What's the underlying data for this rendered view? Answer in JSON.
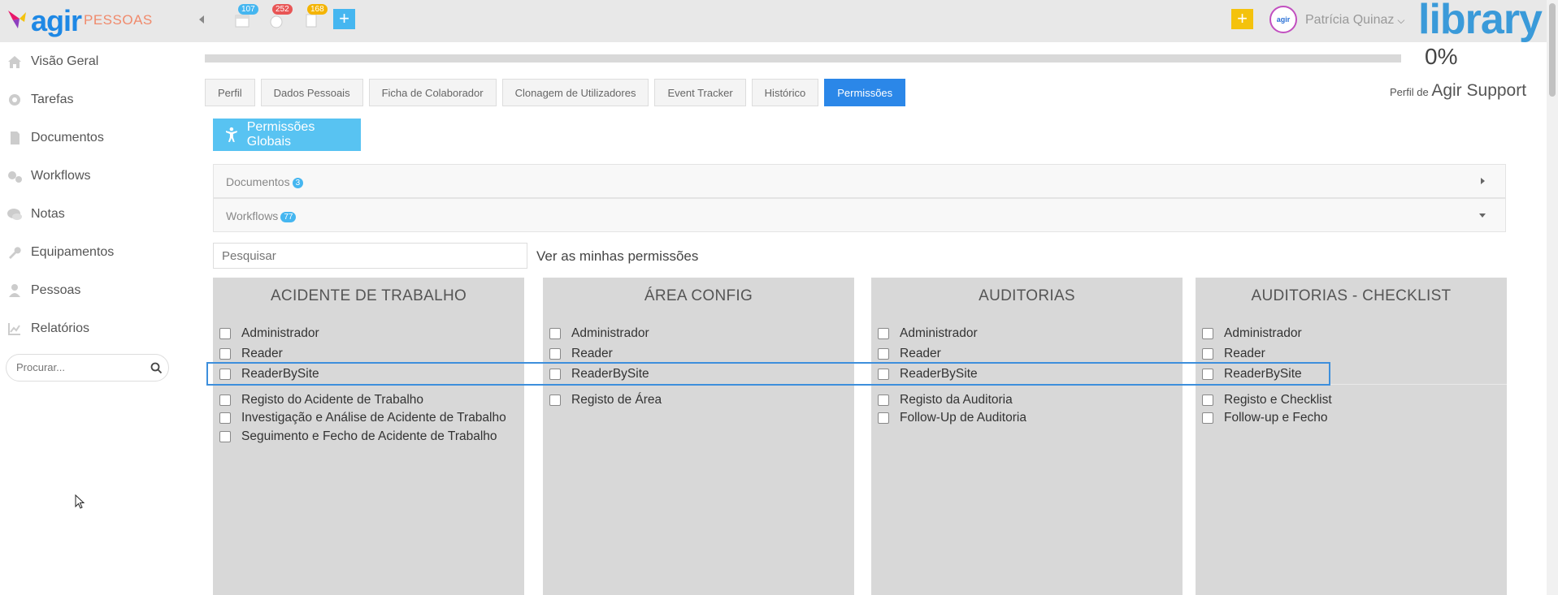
{
  "app": {
    "logo_text": "agir",
    "module": "PESSOAS",
    "brand": "library",
    "accent_color": "#2b87e8",
    "badge_counts": [
      "107",
      "252",
      "168"
    ],
    "user_name": "Patrícia Quinaz",
    "avatar_text": "agir"
  },
  "sidebar": {
    "items": [
      {
        "label": "Visão Geral",
        "icon": "home-icon"
      },
      {
        "label": "Tarefas",
        "icon": "gear-icon"
      },
      {
        "label": "Documentos",
        "icon": "document-icon"
      },
      {
        "label": "Workflows",
        "icon": "gears-icon"
      },
      {
        "label": "Notas",
        "icon": "chat-icon"
      },
      {
        "label": "Equipamentos",
        "icon": "wrench-icon"
      },
      {
        "label": "Pessoas",
        "icon": "person-icon"
      },
      {
        "label": "Relatórios",
        "icon": "chart-icon"
      }
    ],
    "search_placeholder": "Procurar..."
  },
  "progress": {
    "value": 0,
    "label": "0%"
  },
  "tabs": [
    "Perfil",
    "Dados Pessoais",
    "Ficha de Colaborador",
    "Clonagem de Utilizadores",
    "Event Tracker",
    "Histórico",
    "Permissões"
  ],
  "active_tab": "Permissões",
  "profile": {
    "prefix": "Perfil de",
    "name": "Agir Support"
  },
  "global_permissions_label": "Permissões Globais",
  "accordion": [
    {
      "label": "Documentos",
      "count": "3"
    },
    {
      "label": "Workflows",
      "count": "77"
    }
  ],
  "search": {
    "placeholder": "Pesquisar"
  },
  "my_permissions_link": "Ver as minhas permissões",
  "panels": [
    {
      "title": "ACIDENTE DE TRABALHO",
      "roles": [
        "Administrador",
        "Reader",
        "ReaderBySite"
      ],
      "steps": [
        "Registo do Acidente de Trabalho",
        "Investigação e Análise de Acidente de Trabalho",
        "Seguimento e Fecho de Acidente de Trabalho"
      ]
    },
    {
      "title": "ÁREA CONFIG",
      "roles": [
        "Administrador",
        "Reader",
        "ReaderBySite"
      ],
      "steps": [
        "Registo de Área"
      ]
    },
    {
      "title": "AUDITORIAS",
      "roles": [
        "Administrador",
        "Reader",
        "ReaderBySite"
      ],
      "steps": [
        "Registo da Auditoria",
        "Follow-Up de Auditoria"
      ]
    },
    {
      "title": "AUDITORIAS - CHECKLIST",
      "roles": [
        "Administrador",
        "Reader",
        "ReaderBySite"
      ],
      "steps": [
        "Registo e Checklist",
        "Follow-up e Fecho"
      ]
    }
  ]
}
